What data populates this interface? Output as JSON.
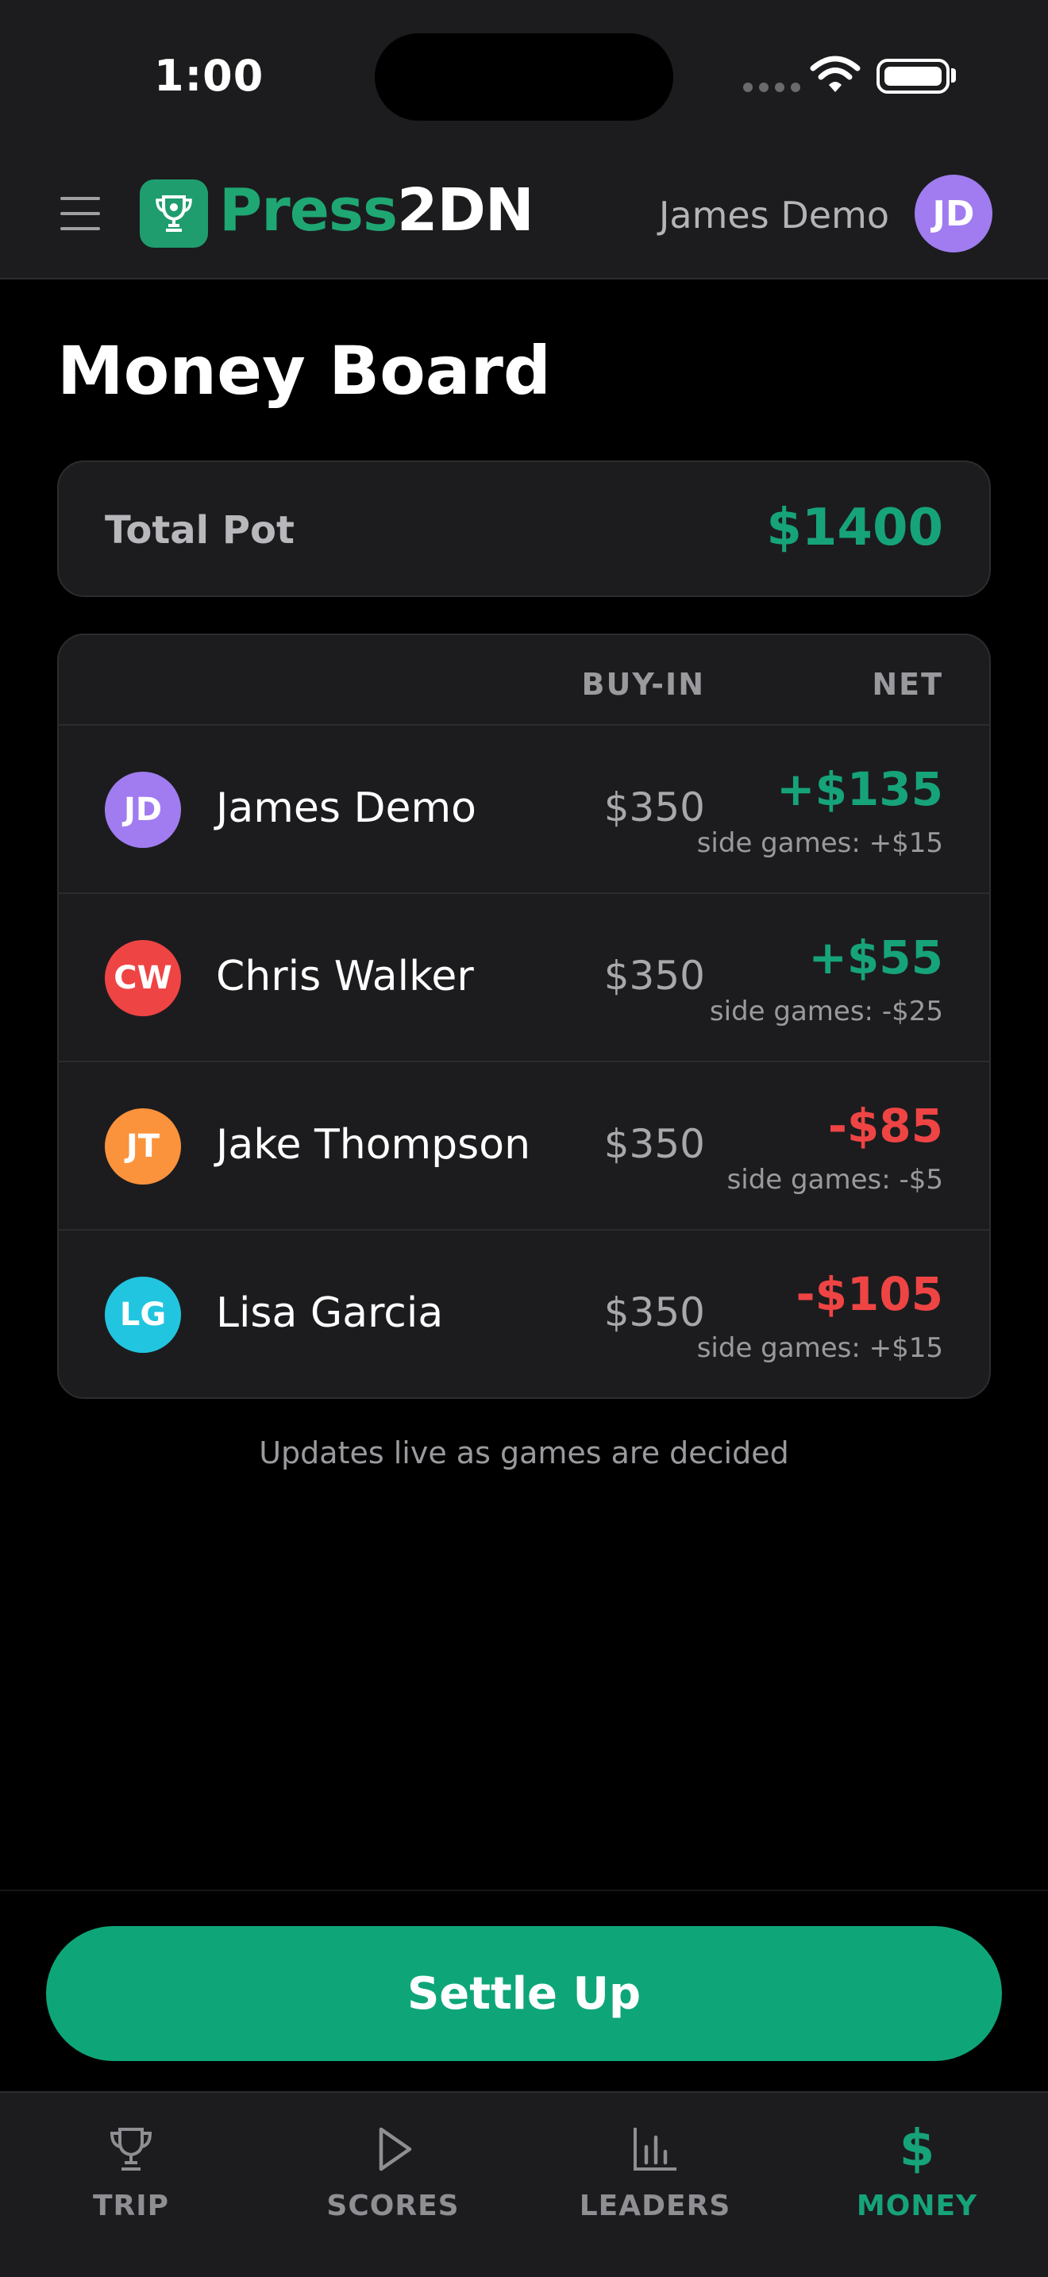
{
  "status_bar": {
    "time": "1:00"
  },
  "header": {
    "logo_part1": "Press",
    "logo_part2": "2DN",
    "user_name": "James Demo",
    "user_initials": "JD"
  },
  "page": {
    "title": "Money Board"
  },
  "pot": {
    "label": "Total Pot",
    "value": "$1400"
  },
  "board": {
    "col_buyin": "BUY-IN",
    "col_net": "NET",
    "rows": [
      {
        "initials": "JD",
        "name": "James Demo",
        "buyin": "$350",
        "net": "+$135",
        "side": "side games: +$15",
        "color": "#a07cf0",
        "tone": "pos"
      },
      {
        "initials": "CW",
        "name": "Chris Walker",
        "buyin": "$350",
        "net": "+$55",
        "side": "side games: -$25",
        "color": "#ef4444",
        "tone": "pos"
      },
      {
        "initials": "JT",
        "name": "Jake Thompson",
        "buyin": "$350",
        "net": "-$85",
        "side": "side games: -$5",
        "color": "#fb923c",
        "tone": "neg"
      },
      {
        "initials": "LG",
        "name": "Lisa Garcia",
        "buyin": "$350",
        "net": "-$105",
        "side": "side games: +$15",
        "color": "#22c5e0",
        "tone": "neg"
      }
    ]
  },
  "live_note": "Updates live as games are decided",
  "settle_label": "Settle Up",
  "tabs": [
    {
      "label": "TRIP",
      "icon": "trophy-icon",
      "active": false
    },
    {
      "label": "SCORES",
      "icon": "play-icon",
      "active": false
    },
    {
      "label": "LEADERS",
      "icon": "bar-chart-icon",
      "active": false
    },
    {
      "label": "MONEY",
      "icon": "dollar-icon",
      "active": true
    }
  ],
  "colors": {
    "accent": "#16a37a",
    "negative": "#ef4444",
    "button": "#0ea678"
  }
}
